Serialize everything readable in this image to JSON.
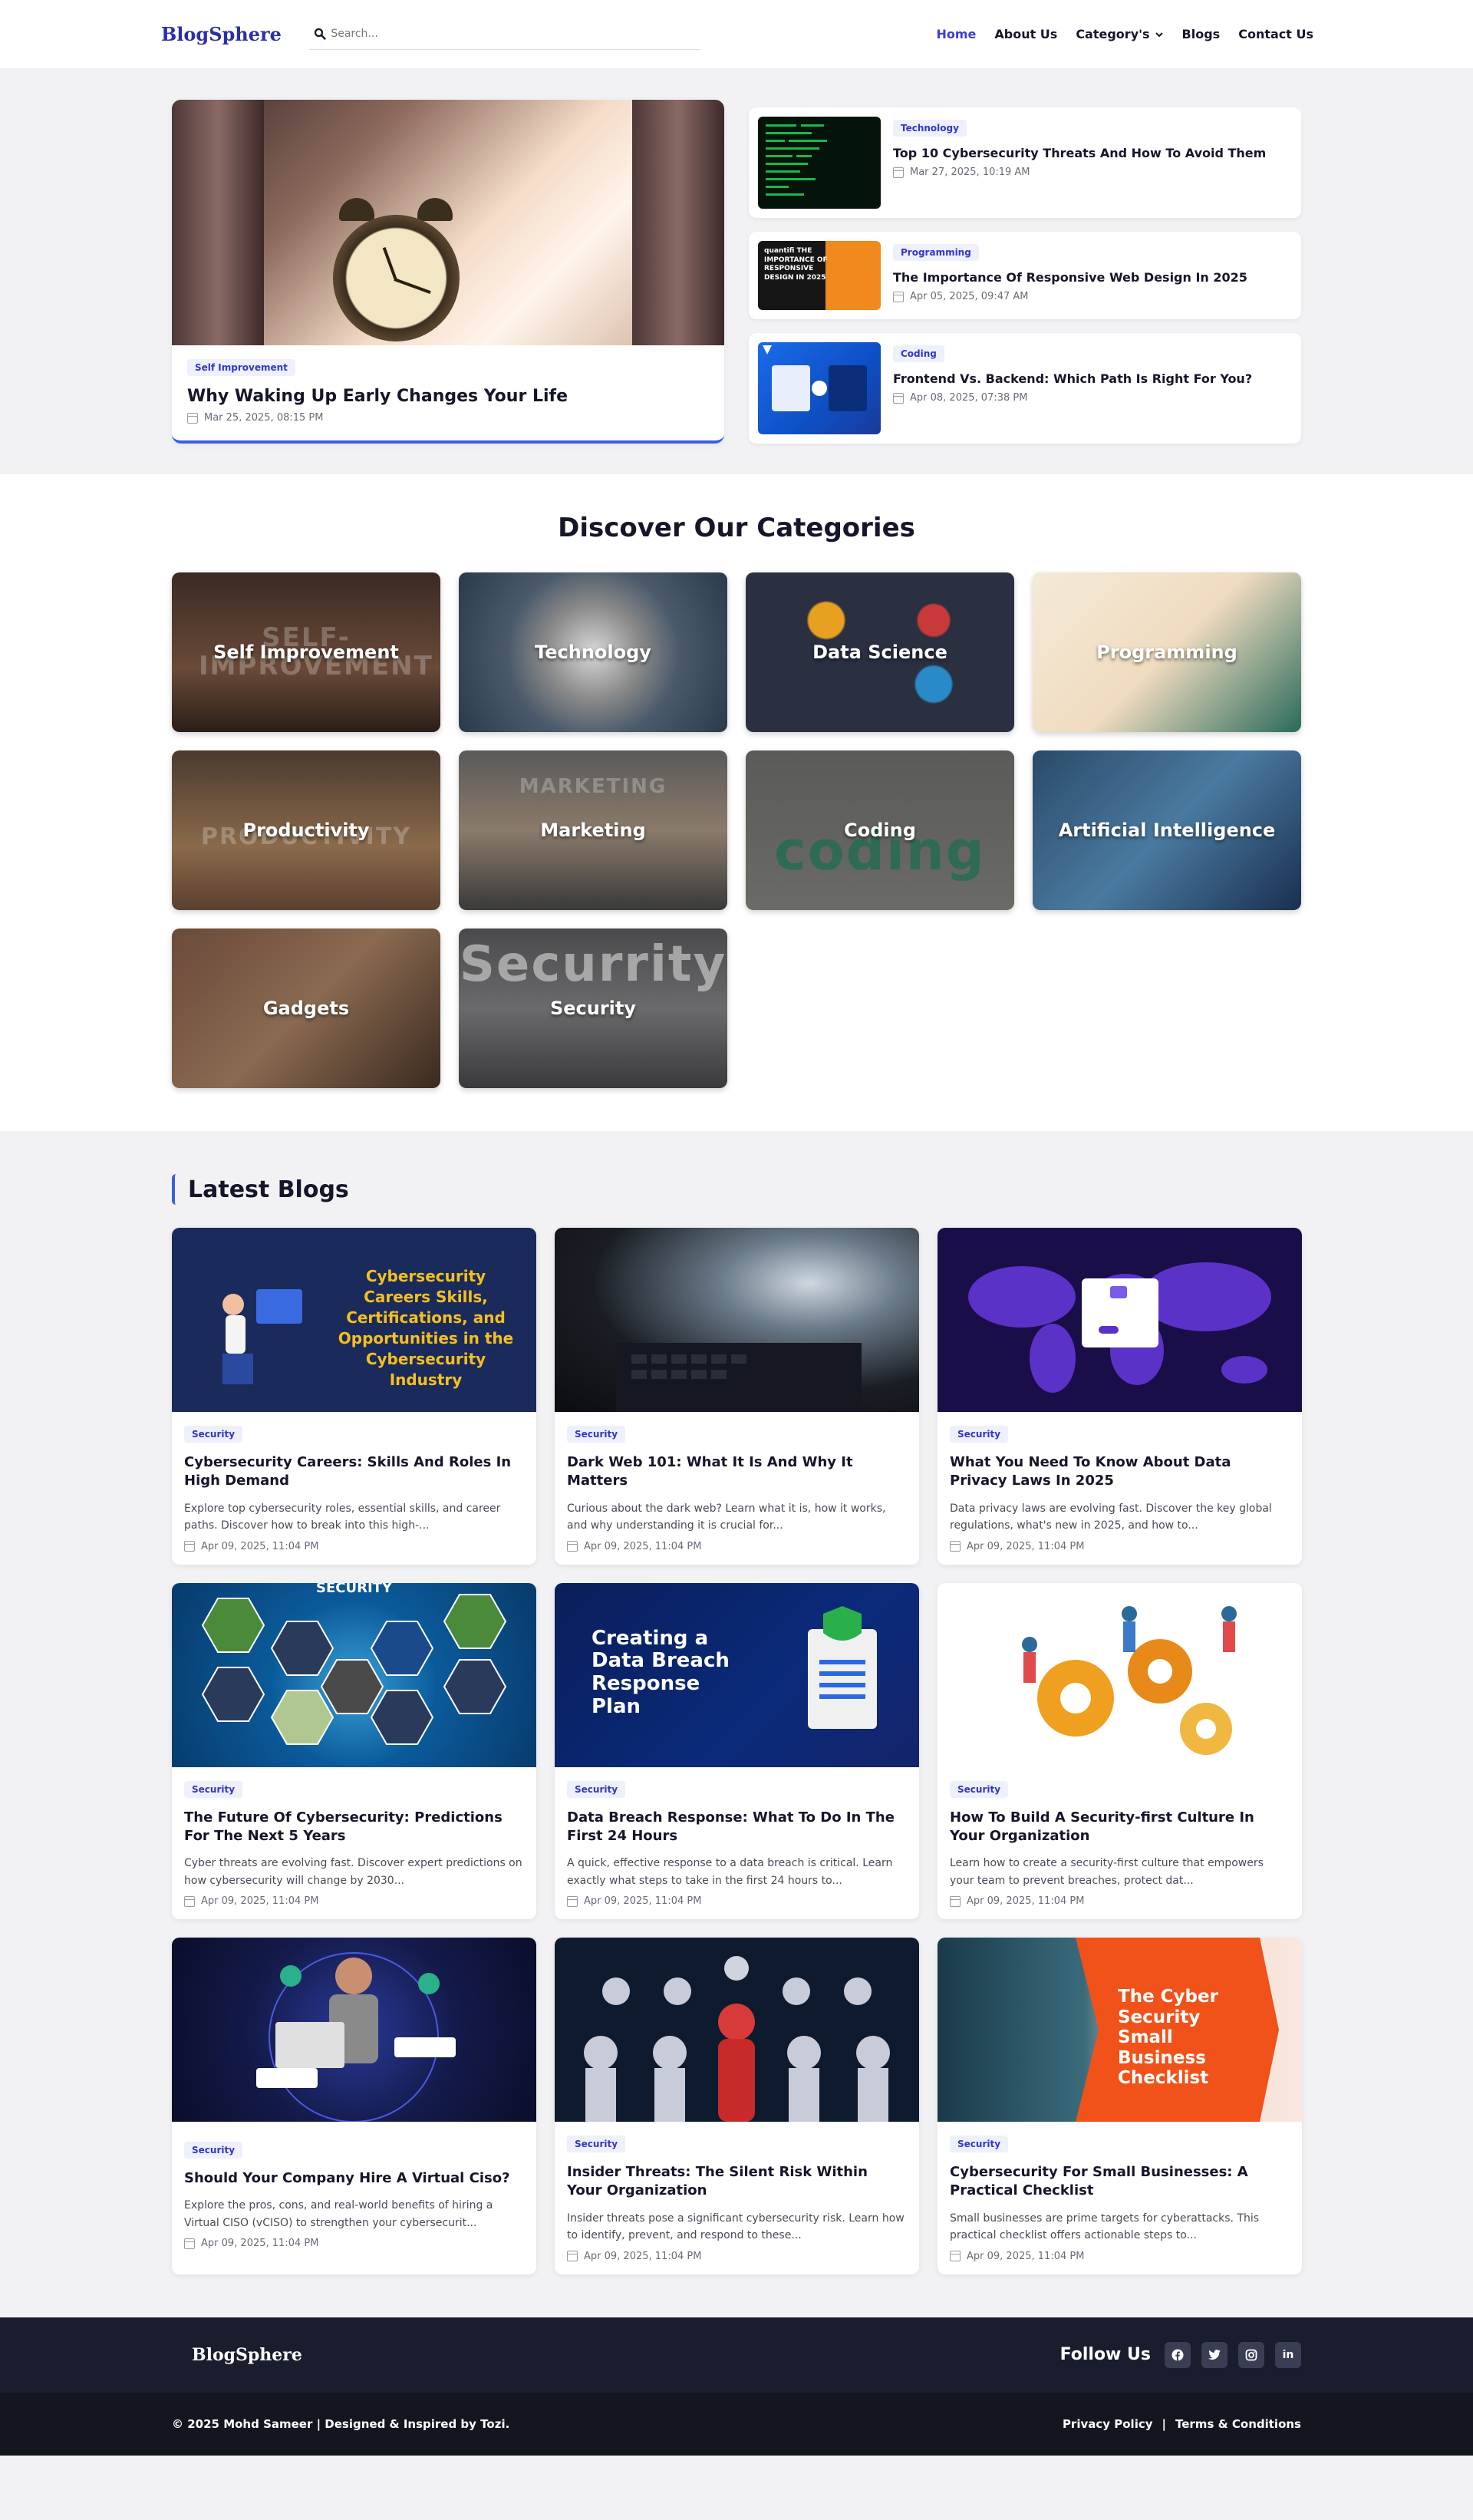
{
  "header": {
    "logo": "BlogSphere",
    "search_placeholder": "Search...",
    "nav": [
      "Home",
      "About Us",
      "Category's",
      "Blogs",
      "Contact Us"
    ]
  },
  "hero": {
    "main": {
      "tag": "Self Improvement",
      "title": "Why Waking Up Early Changes Your Life",
      "date": "Mar 25, 2025, 08:15 PM"
    },
    "side": [
      {
        "tag": "Technology",
        "title": "Top 10 Cybersecurity Threats And How To Avoid Them",
        "date": "Mar 27, 2025, 10:19 AM"
      },
      {
        "tag": "Programming",
        "title": "The Importance Of Responsive Web Design In 2025",
        "date": "Apr 05, 2025, 09:47 AM",
        "thumb_text": "quantifi  THE IMPORTANCE OF RESPONSIVE DESIGN IN 2025"
      },
      {
        "tag": "Coding",
        "title": "Frontend Vs. Backend: Which Path Is Right For You?",
        "date": "Apr 08, 2025, 07:38 PM"
      }
    ]
  },
  "categories": {
    "title": "Discover Our Categories",
    "items": [
      "Self Improvement",
      "Technology",
      "Data Science",
      "Programming",
      "Productivity",
      "Marketing",
      "Coding",
      "Artificial Intelligence",
      "Gadgets",
      "Security"
    ],
    "ghost_text": [
      "SELF-IMPROVEMENT",
      "",
      "",
      "",
      "PRODUCTIVITY",
      "MARKETING",
      "coding",
      "",
      "",
      "Securrity"
    ]
  },
  "latest": {
    "title": "Latest Blogs",
    "posts": [
      {
        "tag": "Security",
        "title": "Cybersecurity Careers: Skills And Roles In High Demand",
        "excerpt": "Explore top cybersecurity roles, essential skills, and career paths. Discover how to break into this high-...",
        "date": "Apr 09, 2025, 11:04 PM",
        "img_text": "Cybersecurity Careers  Skills, Certifications, and Opportunities in the Cybersecurity Industry"
      },
      {
        "tag": "Security",
        "title": "Dark Web 101: What It Is And Why It Matters",
        "excerpt": "Curious about the dark web? Learn what it is, how it works, and why understanding it is crucial for...",
        "date": "Apr 09, 2025, 11:04 PM",
        "img_text": ""
      },
      {
        "tag": "Security",
        "title": "What You Need To Know About Data Privacy Laws In 2025",
        "excerpt": "Data privacy laws are evolving fast. Discover the key global regulations, what's new in 2025, and how to...",
        "date": "Apr 09, 2025, 11:04 PM",
        "img_text": ""
      },
      {
        "tag": "Security",
        "title": "The Future Of Cybersecurity: Predictions For The Next 5 Years",
        "excerpt": "Cyber threats are evolving fast. Discover expert predictions on how cybersecurity will change by 2030...",
        "date": "Apr 09, 2025, 11:04 PM",
        "img_text": "SECURITY"
      },
      {
        "tag": "Security",
        "title": "Data Breach Response: What To Do In The First 24 Hours",
        "excerpt": "A quick, effective response to a data breach is critical. Learn exactly what steps to take in the first 24 hours to...",
        "date": "Apr 09, 2025, 11:04 PM",
        "img_text": "Creating a Data Breach Response Plan"
      },
      {
        "tag": "Security",
        "title": "How To Build A Security-first Culture In Your Organization",
        "excerpt": "Learn how to create a security-first culture that empowers your team to prevent breaches, protect dat...",
        "date": "Apr 09, 2025, 11:04 PM",
        "img_text": ""
      },
      {
        "tag": "Security",
        "title": "Should Your Company Hire A Virtual Ciso?",
        "excerpt": "Explore the pros, cons, and real-world benefits of hiring a Virtual CISO (vCISO) to strengthen your cybersecurit...",
        "date": "Apr 09, 2025, 11:04 PM",
        "img_text": ""
      },
      {
        "tag": "Security",
        "title": "Insider Threats: The Silent Risk Within Your Organization",
        "excerpt": "Insider threats pose a significant cybersecurity risk. Learn how to identify, prevent, and respond to these...",
        "date": "Apr 09, 2025, 11:04 PM",
        "img_text": ""
      },
      {
        "tag": "Security",
        "title": "Cybersecurity For Small Businesses: A Practical Checklist",
        "excerpt": "Small businesses are prime targets for cyberattacks. This practical checklist offers actionable steps to...",
        "date": "Apr 09, 2025, 11:04 PM",
        "img_text": "The Cyber Security Small Business Checklist"
      }
    ]
  },
  "footer": {
    "logo": "BlogSphere",
    "follow": "Follow Us",
    "social": [
      "facebook-icon",
      "twitter-icon",
      "instagram-icon",
      "linkedin-icon"
    ],
    "copyright": "© 2025 Mohd Sameer | Designed & Inspired by Tozi.",
    "links": [
      "Privacy Policy",
      "|",
      "Terms & Conditions"
    ]
  }
}
